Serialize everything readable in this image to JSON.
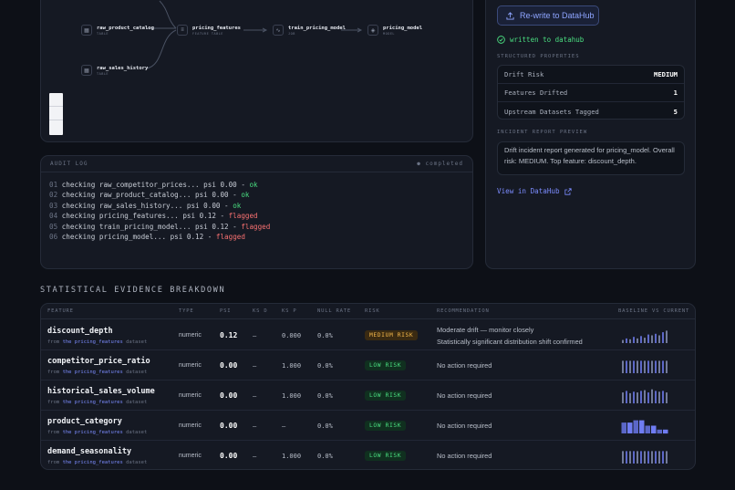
{
  "lineage": {
    "nodes": [
      {
        "name": "raw_product_catalog",
        "type": "TABLE",
        "icon": "table-icon"
      },
      {
        "name": "raw_sales_history",
        "type": "TABLE",
        "icon": "table-icon"
      },
      {
        "name": "pricing_features",
        "type": "FEATURE TABLE",
        "icon": "database-icon"
      },
      {
        "name": "train_pricing_model",
        "type": "JOB",
        "icon": "activity-icon"
      },
      {
        "name": "pricing_model",
        "type": "MODEL",
        "icon": "model-icon"
      }
    ]
  },
  "audit": {
    "title": "AUDIT LOG",
    "status": "completed",
    "lines": [
      {
        "n": "01",
        "text": "checking raw_competitor_prices... psi 0.00 - ",
        "result": "ok"
      },
      {
        "n": "02",
        "text": "checking raw_product_catalog... psi 0.00 - ",
        "result": "ok"
      },
      {
        "n": "03",
        "text": "checking raw_sales_history... psi 0.00 - ",
        "result": "ok"
      },
      {
        "n": "04",
        "text": "checking pricing_features... psi 0.12 - ",
        "result": "flagged"
      },
      {
        "n": "05",
        "text": "checking train_pricing_model... psi 0.12 - ",
        "result": "flagged"
      },
      {
        "n": "06",
        "text": "checking pricing_model... psi 0.12 - ",
        "result": "flagged"
      }
    ]
  },
  "right": {
    "rewrite_button": "Re-write to DataHub",
    "written_status": "written to datahub",
    "props_title": "STRUCTURED PROPERTIES",
    "props": [
      {
        "key": "Drift Risk",
        "value": "MEDIUM"
      },
      {
        "key": "Features Drifted",
        "value": "1"
      },
      {
        "key": "Upstream Datasets Tagged",
        "value": "5"
      }
    ],
    "report_title": "INCIDENT REPORT PREVIEW",
    "report_text": "Drift incident report generated for pricing_model. Overall risk: MEDIUM. Top feature: discount_depth.",
    "view_link": "View in DataHub"
  },
  "evidence": {
    "title": "STATISTICAL EVIDENCE BREAKDOWN",
    "columns": [
      "FEATURE",
      "TYPE",
      "PSI",
      "KS D",
      "KS P",
      "NULL RATE",
      "RISK",
      "RECOMMENDATION",
      "BASELINE VS CURRENT"
    ],
    "from_prefix": "from ",
    "dataset": "the pricing_features",
    "dataset_suffix": " dataset",
    "rows": [
      {
        "feature": "discount_depth",
        "type": "numeric",
        "psi": "0.12",
        "ksd": "—",
        "ksp": "0.000",
        "null": "0.0%",
        "risk": "MEDIUM RISK",
        "level": "med",
        "rec": [
          "Moderate drift — monitor closely",
          "Statistically significant distribution shift confirmed"
        ],
        "spark": [
          0.2,
          0.3,
          0.25,
          0.4,
          0.3,
          0.45,
          0.35,
          0.55,
          0.5,
          0.6,
          0.5,
          0.7,
          0.8
        ]
      },
      {
        "feature": "competitor_price_ratio",
        "type": "numeric",
        "psi": "0.00",
        "ksd": "—",
        "ksp": "1.000",
        "null": "0.0%",
        "risk": "LOW RISK",
        "level": "low",
        "rec": [
          "No action required"
        ],
        "spark": [
          0.8,
          0.8,
          0.8,
          0.8,
          0.8,
          0.8,
          0.8,
          0.8,
          0.8,
          0.8,
          0.8,
          0.8,
          0.8
        ]
      },
      {
        "feature": "historical_sales_volume",
        "type": "numeric",
        "psi": "0.00",
        "ksd": "—",
        "ksp": "1.000",
        "null": "0.0%",
        "risk": "LOW RISK",
        "level": "low",
        "rec": [
          "No action required"
        ],
        "spark": [
          0.7,
          0.8,
          0.65,
          0.75,
          0.7,
          0.8,
          0.85,
          0.7,
          0.9,
          0.8,
          0.75,
          0.8,
          0.7
        ]
      },
      {
        "feature": "product_category",
        "type": "numeric",
        "psi": "0.00",
        "ksd": "—",
        "ksp": "—",
        "null": "0.0%",
        "risk": "LOW RISK",
        "level": "low",
        "rec": [
          "No action required"
        ],
        "spark": [
          0.7,
          0.7,
          0.85,
          0.85,
          0.5,
          0.5,
          0.25,
          0.25
        ]
      },
      {
        "feature": "demand_seasonality",
        "type": "numeric",
        "psi": "0.00",
        "ksd": "—",
        "ksp": "1.000",
        "null": "0.0%",
        "risk": "LOW RISK",
        "level": "low",
        "rec": [
          "No action required"
        ],
        "spark": [
          0.8,
          0.8,
          0.8,
          0.8,
          0.8,
          0.8,
          0.8,
          0.8,
          0.8,
          0.8,
          0.8,
          0.8,
          0.8
        ]
      }
    ]
  }
}
